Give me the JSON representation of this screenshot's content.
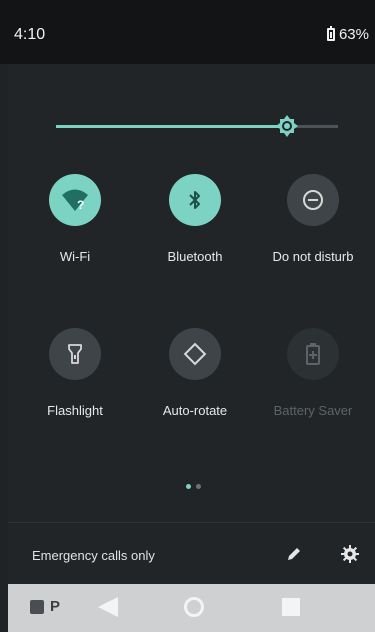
{
  "status": {
    "time": "4:10",
    "battery": "63%"
  },
  "brightness": {
    "level": 0.82
  },
  "tiles": [
    {
      "label": "Wi-Fi",
      "icon": "wifi-question-icon",
      "state": "on"
    },
    {
      "label": "Bluetooth",
      "icon": "bluetooth-icon",
      "state": "on"
    },
    {
      "label": "Do not disturb",
      "icon": "do-not-disturb-icon",
      "state": "off"
    },
    {
      "label": "Flashlight",
      "icon": "flashlight-icon",
      "state": "off"
    },
    {
      "label": "Auto-rotate",
      "icon": "auto-rotate-icon",
      "state": "off"
    },
    {
      "label": "Battery Saver",
      "icon": "battery-saver-icon",
      "state": "disabled"
    }
  ],
  "pager": {
    "pages": 2,
    "current": 1
  },
  "footer": {
    "text": "Emergency calls only"
  },
  "colors": {
    "accent": "#7dd3c3",
    "panel": "#212528",
    "tile_off": "#3e4447"
  }
}
